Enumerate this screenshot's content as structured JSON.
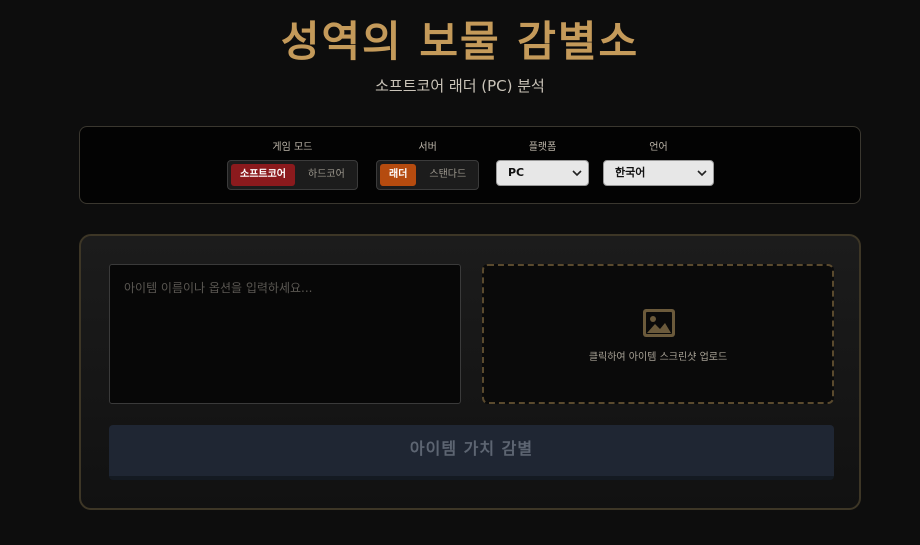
{
  "header": {
    "title": "성역의 보물 감별소",
    "subtitle": "소프트코어 래더 (PC) 분석"
  },
  "settings": {
    "game_mode": {
      "label": "게임 모드",
      "options": [
        "소프트코어",
        "하드코어"
      ],
      "selected": "소프트코어"
    },
    "server": {
      "label": "서버",
      "options": [
        "래더",
        "스탠다드"
      ],
      "selected": "래더"
    },
    "platform": {
      "label": "플랫폼",
      "selected": "PC"
    },
    "language": {
      "label": "언어",
      "selected": "한국어"
    }
  },
  "input": {
    "placeholder": "아이템 이름이나 옵션을 입력하세요..."
  },
  "upload": {
    "icon": "image-icon",
    "text": "클릭하여 아이템 스크린샷 업로드"
  },
  "submit": {
    "label": "아이템 가치 감별"
  },
  "colors": {
    "title_gold": "#c49a5a",
    "active_red": "#8b1a1d",
    "active_orange": "#b54b0f",
    "submit_bg": "#1f2633"
  }
}
